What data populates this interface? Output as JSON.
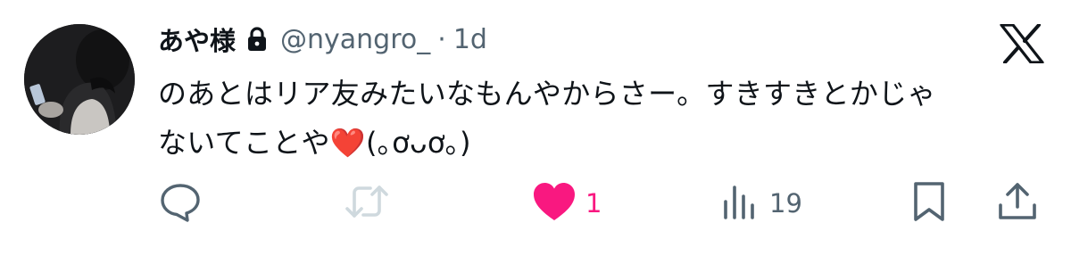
{
  "user": {
    "display_name": "あや様",
    "handle": "@nyangro_",
    "separator": "·",
    "time": "1d",
    "avatar_icon": "avatar",
    "lock_icon": "lock-icon"
  },
  "brand": {
    "logo_icon": "x-logo-icon"
  },
  "tweet": {
    "text": "のあとはリア友みたいなもんやからさー。すきすきとかじゃ\nないてことや❤️(｡ơᴗơ｡)"
  },
  "actions": {
    "reply": {
      "icon": "reply-icon",
      "count": ""
    },
    "retweet": {
      "icon": "retweet-icon",
      "count": "",
      "enabled": false
    },
    "like": {
      "icon": "heart-icon",
      "count": "1",
      "liked": true
    },
    "views": {
      "icon": "views-icon",
      "count": "19"
    },
    "bookmark": {
      "icon": "bookmark-icon"
    },
    "share": {
      "icon": "share-icon"
    }
  },
  "colors": {
    "text": "#0f1419",
    "secondary": "#536471",
    "like": "#f91880",
    "disabled": "#cfd9de"
  }
}
